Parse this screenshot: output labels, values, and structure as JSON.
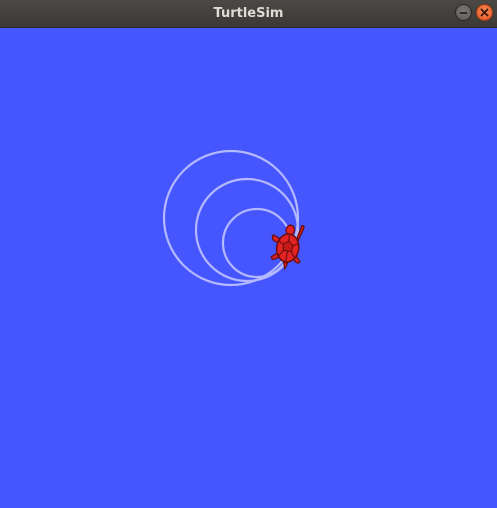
{
  "window": {
    "title": "TurtleSim",
    "minimize_icon": "minimize-icon",
    "close_icon": "close-icon"
  },
  "canvas": {
    "background_color": "#4556ff",
    "pen_color": "#b3b8ff"
  },
  "turtle": {
    "icon": "turtle-icon",
    "body_color": "#e32323",
    "outline_color": "#6b0c0c"
  }
}
